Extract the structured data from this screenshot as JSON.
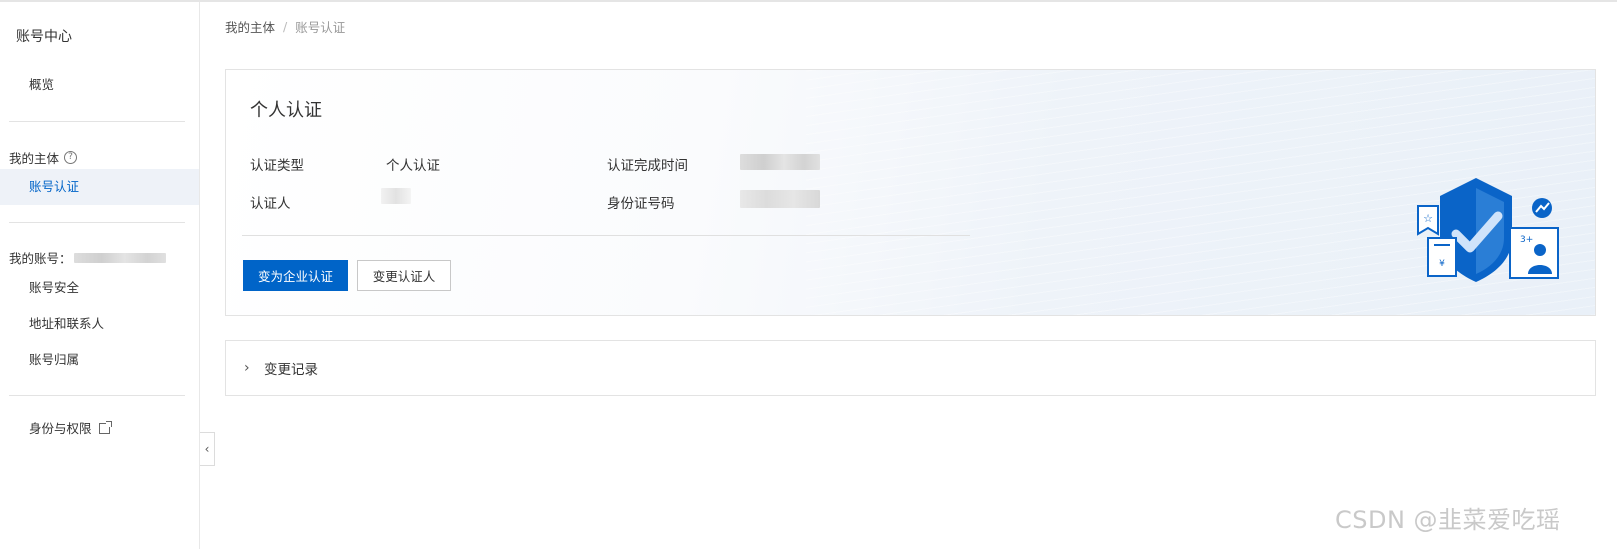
{
  "sidebar": {
    "title": "账号中心",
    "overview": "概览",
    "group_subject": "我的主体",
    "help_glyph": "?",
    "account_auth": "账号认证",
    "group_account": "我的账号：",
    "account_security": "账号安全",
    "address_contacts": "地址和联系人",
    "account_ownership": "账号归属",
    "identity_permissions": "身份与权限",
    "collapse_glyph": "‹"
  },
  "breadcrumb": {
    "root": "我的主体",
    "separator": "/",
    "current": "账号认证"
  },
  "auth_card": {
    "title": "个人认证",
    "type_label": "认证类型",
    "type_value": "个人认证",
    "person_label": "认证人",
    "completed_label": "认证完成时间",
    "id_label": "身份证号码",
    "primary_button": "变为企业认证",
    "secondary_button": "变更认证人",
    "illustration_badge": "3+"
  },
  "records": {
    "chevron": "›",
    "label": "变更记录"
  },
  "watermark": "CSDN @韭菜爱吃瑶",
  "colors": {
    "primary": "#0064c8",
    "active_bg": "#eef2f8"
  }
}
